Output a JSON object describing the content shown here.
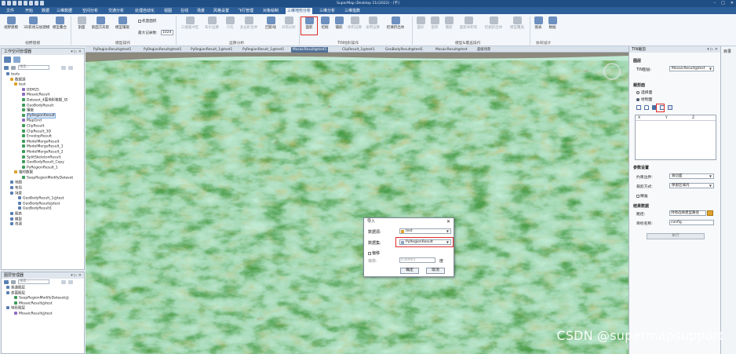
{
  "app": {
    "title": "SuperMap iDesktop 11i(2022) - [不]"
  },
  "menu_tabs": [
    "文件",
    "开始",
    "数据",
    "三维数据",
    "空间分析",
    "交通分析",
    "处理自动化",
    "视图",
    "在线",
    "场景",
    "风格设置",
    "飞行管理",
    "对象绘制",
    "三维地形分析",
    "三维分析",
    "三维指数"
  ],
  "ribbon": {
    "buttons": [
      {
        "label": "视野建模"
      },
      {
        "label": "3D影视与加建模"
      },
      {
        "label": "模型叠合"
      },
      {
        "label": "剖面"
      },
      {
        "label": "剖面方形影"
      },
      {
        "label": "模型镶嵌"
      },
      {
        "label": "三维缓冲区"
      },
      {
        "label": "布尔运算"
      },
      {
        "label": "凸包"
      },
      {
        "label": "多边形合并"
      },
      {
        "label": "回影线"
      },
      {
        "label": "日照分析"
      },
      {
        "label": "面影"
      },
      {
        "label": "挖掘"
      },
      {
        "label": "镶嵌"
      },
      {
        "label": "体积运算"
      },
      {
        "label": "采用运算"
      },
      {
        "label": "挖填挤出体"
      },
      {
        "label": "面形"
      },
      {
        "label": "面积"
      },
      {
        "label": "镶嵌"
      },
      {
        "label": "面影体积等"
      },
      {
        "label": "挖掘挤出体"
      },
      {
        "label": "模型覆盖"
      },
      {
        "label": "图表"
      },
      {
        "label": "数据"
      }
    ],
    "checkbox_label": "机量面积",
    "max_records_label": "最大记录数:",
    "max_records_value": "1024",
    "groups": [
      "视野建模",
      "模型操作",
      "运算分析",
      "TIN地形操作",
      "模型&覆盖操作",
      "协同设计"
    ]
  },
  "workspace_panel": {
    "title": "工作空间管理器",
    "search_placeholder": "搜索...",
    "nodes": [
      "tests",
      "数据源",
      "test",
      "DEM25",
      "MosaicResult",
      "Dataset_4面地形数据_切",
      "GeoBodyResult",
      "镶嵌",
      "PyRegionResult",
      "MapGrid",
      "ClipResult",
      "ClipResult_3D",
      "EnvelopResult",
      "ModelMergeResult",
      "ModelMergeResult_1",
      "ModelMergeResult_2",
      "SplitSkeletonResult",
      "GeoBodyResult_Copy",
      "PyRegionResult_1",
      "临时数据",
      "SeepRegionModifyDataset",
      "地图",
      "布局",
      "场景",
      "GeoBodyResult_1@test",
      "GeoBodyResult@test",
      "GeoBodyResult1",
      "图表",
      "模型",
      "资源"
    ]
  },
  "layer_panel": {
    "title": "图层管理器",
    "search_placeholder": "搜索...",
    "nodes": [
      "普通图层",
      "表面图层",
      "SeepRegionModifyDataset@",
      "MosaicResult@test",
      "地形图层",
      "MosaicResult@test"
    ]
  },
  "doc_tabs": [
    "PyRegionResult@test1",
    "PyRegionResult@test1",
    "PyRegionResult_1@test1",
    "PyRegionResult_1@test1",
    "MosaicResult@test1",
    "ClipResult_1@test1",
    "GeoBodyResult@test1",
    "MosaicResult@test",
    "超级场景"
  ],
  "dialog": {
    "title": "导入",
    "datasource_label": "数据源:",
    "datasource_value": "test",
    "dataset_label": "数据集:",
    "dataset_value": "PyRegionResult",
    "offset_checkbox": "偏移",
    "offset_label": "偏移:",
    "offset_value": "0.00001",
    "unit": "度",
    "ok": "确定",
    "cancel": "取消"
  },
  "right_panel": {
    "title": "TIN裁剪",
    "layer_section": "图层",
    "tin_layer_label": "TIN图层:",
    "tin_layer_value": "MosaicResult@test",
    "clip_section": "裁剪面",
    "radio_select": "选择面",
    "radio_draw": "绘制面",
    "table_headers": [
      "X",
      "Y",
      "Z"
    ],
    "params_section": "参数设置",
    "clip_boundary_label": "约束边界:",
    "clip_boundary_value": "裁切面",
    "clip_mode_label": "裁剪方式:",
    "clip_mode_value": "保留区域内",
    "precise_label": "精准",
    "result_section": "结果数据",
    "path_label": "路径:",
    "path_value": "持地选择建型路径",
    "target_label": "目标名称:",
    "target_value": "config",
    "execute": "执行"
  },
  "far_right": {
    "title": "目录"
  },
  "watermark": "CSDN @supermapsupport",
  "colors": {
    "title_bar": "#1f4e85",
    "menu_bar": "#2d5f9a",
    "highlight": "#e02b2b",
    "terrain_low": "#bfe9d3",
    "terrain_mid": "#3f9a2f",
    "terrain_high": "#c9411f"
  }
}
